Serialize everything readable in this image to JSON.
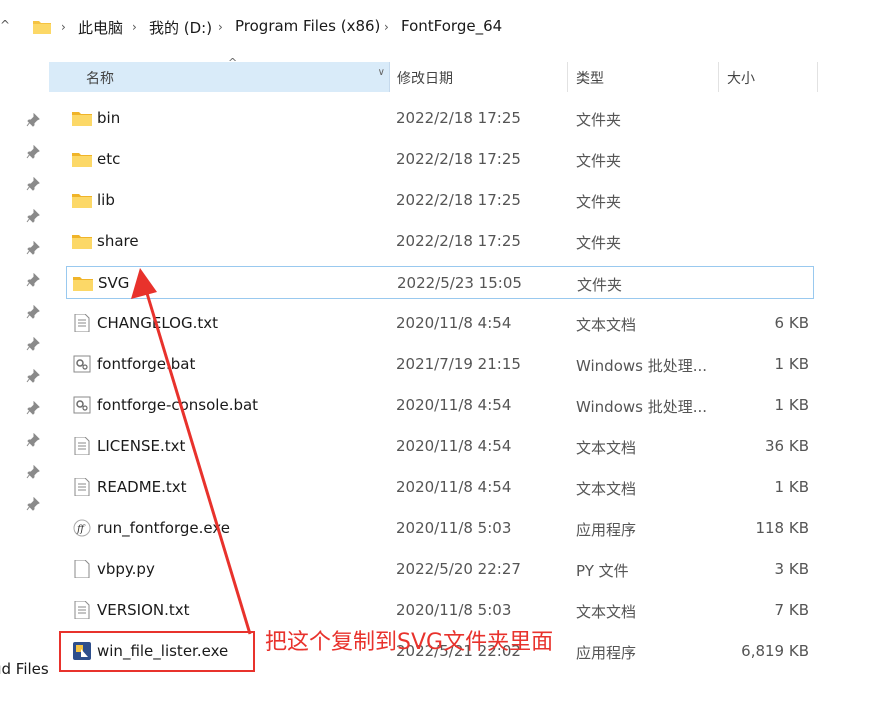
{
  "address": {
    "breadcrumbs": [
      "此电脑",
      "我的 (D:)",
      "Program Files (x86)",
      "FontForge_64"
    ]
  },
  "nav": {
    "partial_label": "ud Files"
  },
  "columns": {
    "name": "名称",
    "date": "修改日期",
    "type": "类型",
    "size": "大小"
  },
  "files": [
    {
      "name": "bin",
      "date": "2022/2/18 17:25",
      "type": "文件夹",
      "size": "",
      "icon": "folder-icon"
    },
    {
      "name": "etc",
      "date": "2022/2/18 17:25",
      "type": "文件夹",
      "size": "",
      "icon": "folder-icon"
    },
    {
      "name": "lib",
      "date": "2022/2/18 17:25",
      "type": "文件夹",
      "size": "",
      "icon": "folder-icon"
    },
    {
      "name": "share",
      "date": "2022/2/18 17:25",
      "type": "文件夹",
      "size": "",
      "icon": "folder-icon"
    },
    {
      "name": "SVG",
      "date": "2022/5/23 15:05",
      "type": "文件夹",
      "size": "",
      "icon": "folder-icon"
    },
    {
      "name": "CHANGELOG.txt",
      "date": "2020/11/8 4:54",
      "type": "文本文档",
      "size": "6 KB",
      "icon": "text-file-icon"
    },
    {
      "name": "fontforge.bat",
      "date": "2021/7/19 21:15",
      "type": "Windows 批处理...",
      "size": "1 KB",
      "icon": "batch-file-icon"
    },
    {
      "name": "fontforge-console.bat",
      "date": "2020/11/8 4:54",
      "type": "Windows 批处理...",
      "size": "1 KB",
      "icon": "batch-file-icon"
    },
    {
      "name": "LICENSE.txt",
      "date": "2020/11/8 4:54",
      "type": "文本文档",
      "size": "36 KB",
      "icon": "text-file-icon"
    },
    {
      "name": "README.txt",
      "date": "2020/11/8 4:54",
      "type": "文本文档",
      "size": "1 KB",
      "icon": "text-file-icon"
    },
    {
      "name": "run_fontforge.exe",
      "date": "2020/11/8 5:03",
      "type": "应用程序",
      "size": "118 KB",
      "icon": "fontforge-app-icon"
    },
    {
      "name": "vbpy.py",
      "date": "2022/5/20 22:27",
      "type": "PY 文件",
      "size": "3 KB",
      "icon": "blank-file-icon"
    },
    {
      "name": "VERSION.txt",
      "date": "2020/11/8 5:03",
      "type": "文本文档",
      "size": "7 KB",
      "icon": "text-file-icon"
    },
    {
      "name": "win_file_lister.exe",
      "date": "2022/5/21 22:02",
      "type": "应用程序",
      "size": "6,819 KB",
      "icon": "exe-app-icon"
    }
  ],
  "annotation": {
    "text": "把这个复制到SVG文件夹里面",
    "color": "#e8322c"
  },
  "colors": {
    "header_selected": "#d9ebf9",
    "row_selected_border": "#99c9ef",
    "folder": "#f5c342"
  }
}
